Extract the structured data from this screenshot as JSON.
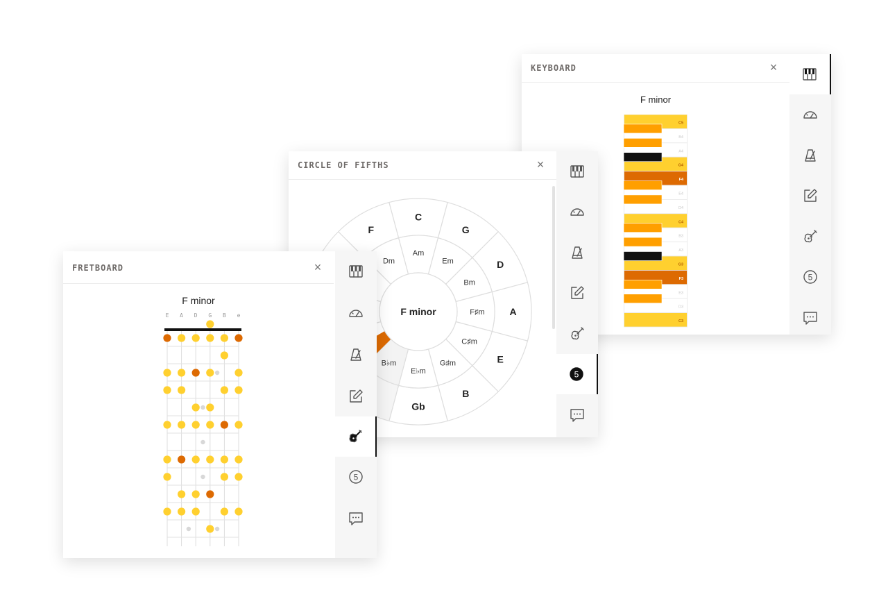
{
  "colors": {
    "gold": "#ffd02f",
    "amber": "#ff9f00",
    "orange": "#dd6a02",
    "black": "#111111",
    "grey": "#d8d8d8"
  },
  "keyboard": {
    "window_title": "KEYBOARD",
    "close_icon": "×",
    "title": "F minor",
    "white_keys": [
      {
        "label": "C5",
        "state": "gold"
      },
      {
        "label": "B4",
        "state": "none"
      },
      {
        "label": "A4",
        "state": "none"
      },
      {
        "label": "G4",
        "state": "gold"
      },
      {
        "label": "F4",
        "state": "root"
      },
      {
        "label": "E4",
        "state": "none"
      },
      {
        "label": "D4",
        "state": "none"
      },
      {
        "label": "C4",
        "state": "gold"
      },
      {
        "label": "B3",
        "state": "none"
      },
      {
        "label": "A3",
        "state": "none"
      },
      {
        "label": "G3",
        "state": "gold"
      },
      {
        "label": "F3",
        "state": "root"
      },
      {
        "label": "E3",
        "state": "none"
      },
      {
        "label": "D3",
        "state": "none"
      },
      {
        "label": "C3",
        "state": "gold"
      }
    ],
    "black_keys": [
      {
        "between": 1,
        "state": "amber"
      },
      {
        "between": 2,
        "state": "amber"
      },
      {
        "between": 3,
        "state": "black"
      },
      {
        "between": 5,
        "state": "amber"
      },
      {
        "between": 6,
        "state": "amber"
      },
      {
        "between": 8,
        "state": "amber"
      },
      {
        "between": 9,
        "state": "amber"
      },
      {
        "between": 10,
        "state": "black"
      },
      {
        "between": 12,
        "state": "amber"
      },
      {
        "between": 13,
        "state": "amber"
      }
    ]
  },
  "circle": {
    "window_title": "CIRCLE OF FIFTHS",
    "close_icon": "×",
    "center_label": "F minor",
    "outer": [
      "C",
      "G",
      "D",
      "A",
      "E",
      "B",
      "Gb",
      "",
      "",
      "",
      "",
      "F"
    ],
    "inner": [
      "Am",
      "Em",
      "Bm",
      "F♯m",
      "C♯m",
      "G♯m",
      "E♭m",
      "B♭m",
      "",
      "",
      "",
      "Dm"
    ]
  },
  "fretboard": {
    "window_title": "FRETBOARD",
    "close_icon": "×",
    "title": "F minor",
    "strings": [
      "E",
      "A",
      "D",
      "G",
      "B",
      "e"
    ],
    "open_dots": [
      {
        "string": 3,
        "type": "gold"
      }
    ],
    "frets": [
      [
        "root",
        "gold",
        "gold",
        "gold",
        "gold",
        "root"
      ],
      [
        "none",
        "none",
        "none",
        "none",
        "gold",
        "none"
      ],
      [
        "gold",
        "gold",
        "root",
        "gold",
        "none",
        "gold"
      ],
      [
        "gold",
        "gold",
        "none",
        "none",
        "gold",
        "gold"
      ],
      [
        "none",
        "none",
        "gold",
        "gold",
        "none",
        "none"
      ],
      [
        "gold",
        "gold",
        "gold",
        "gold",
        "root",
        "gold"
      ],
      [
        "none",
        "none",
        "none",
        "none",
        "none",
        "none"
      ],
      [
        "gold",
        "root",
        "gold",
        "gold",
        "gold",
        "gold"
      ],
      [
        "gold",
        "none",
        "none",
        "none",
        "gold",
        "gold"
      ],
      [
        "none",
        "gold",
        "gold",
        "root",
        "none",
        "none"
      ],
      [
        "gold",
        "gold",
        "gold",
        "none",
        "gold",
        "gold"
      ],
      [
        "none",
        "none",
        "none",
        "gold",
        "none",
        "none"
      ]
    ],
    "grey_dots": [
      [
        2,
        3.5
      ],
      [
        4,
        2.5
      ],
      [
        6,
        2.5
      ],
      [
        8,
        2.5
      ],
      [
        11,
        1.5
      ],
      [
        11,
        3.5
      ]
    ]
  },
  "sidebar": {
    "items": [
      {
        "icon": "keyboard-icon"
      },
      {
        "icon": "tuner-icon"
      },
      {
        "icon": "metronome-icon"
      },
      {
        "icon": "notes-icon"
      },
      {
        "icon": "guitar-icon"
      },
      {
        "icon": "circle-of-fifths-icon",
        "glyph": "5"
      },
      {
        "icon": "chat-icon"
      }
    ]
  }
}
